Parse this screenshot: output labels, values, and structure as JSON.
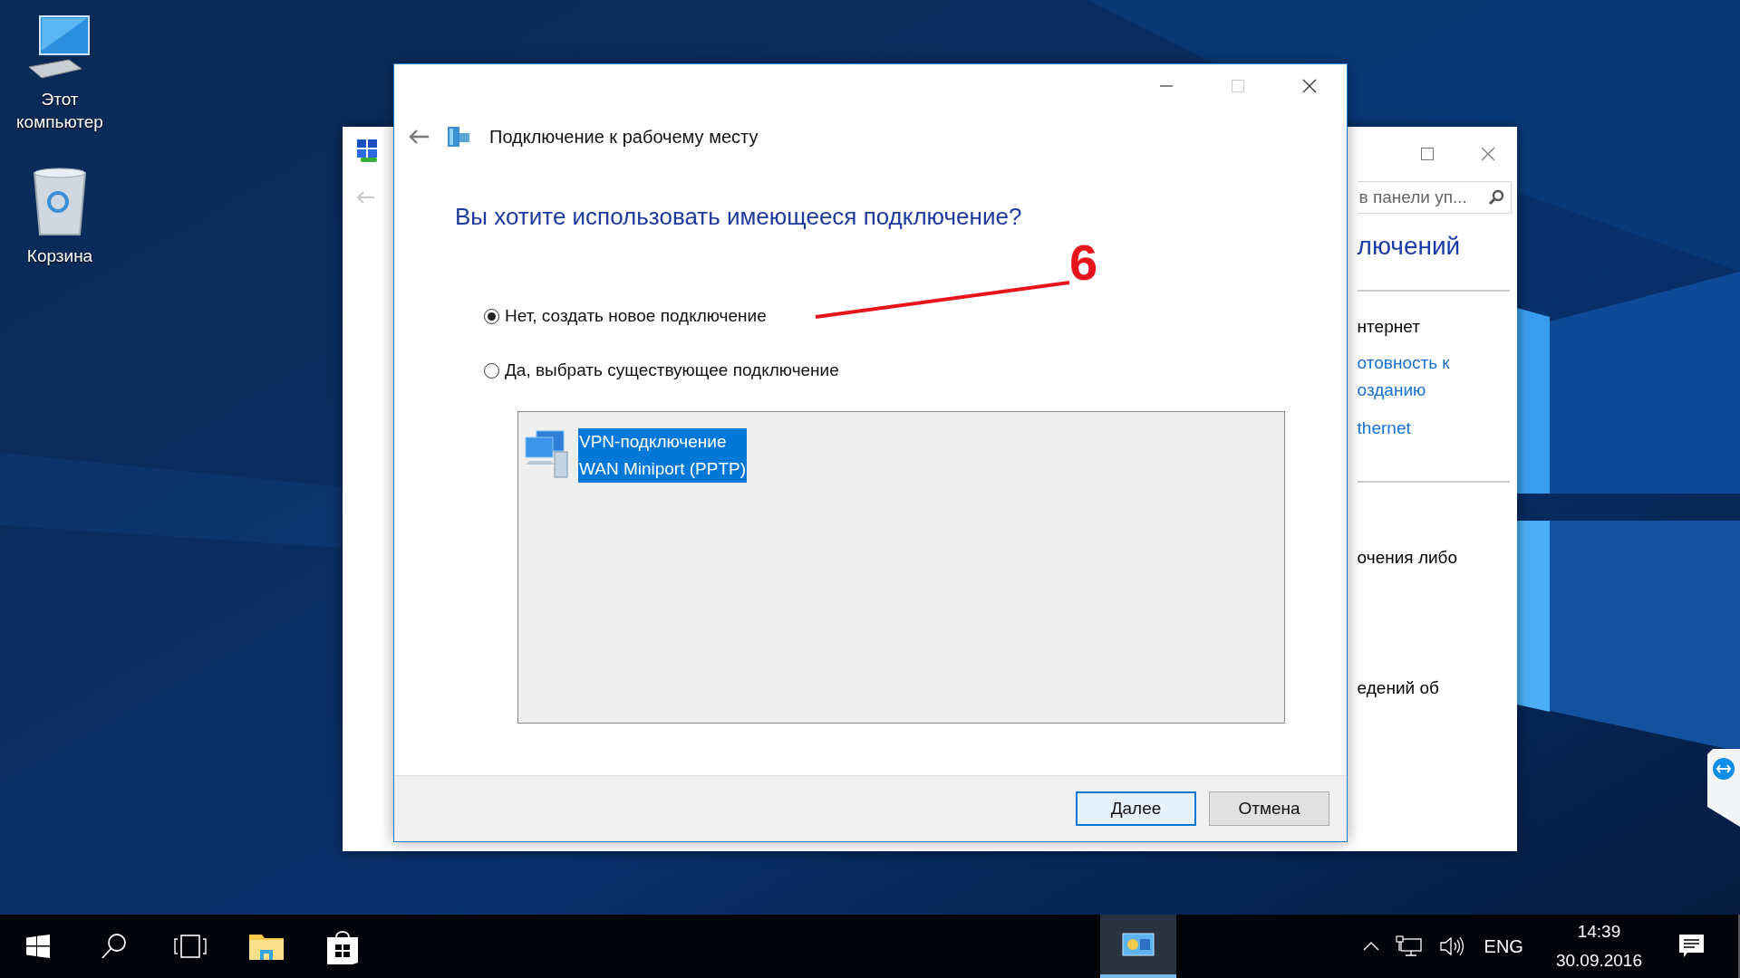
{
  "desktop_icons": [
    {
      "kind": "computer",
      "label": "Этот компьютер"
    },
    {
      "kind": "recycle-bin",
      "label": "Корзина"
    }
  ],
  "background_window": {
    "search": {
      "placeholder": "в панели уп..."
    },
    "heading": "лючений",
    "groups": [
      {
        "lines": [
          {
            "kind": "text",
            "text": "нтернет"
          },
          {
            "kind": "link",
            "text": "отовность к"
          },
          {
            "kind": "link",
            "text": "озданию"
          },
          {
            "kind": "link",
            "text": "thernet"
          }
        ]
      },
      {
        "lines": [
          {
            "kind": "text",
            "text": "очения либо"
          },
          {
            "kind": "text",
            "text": "едений об"
          }
        ]
      }
    ]
  },
  "dialog": {
    "title": "Подключение к рабочему месту",
    "question": "Вы хотите использовать имеющееся подключение?",
    "options": [
      {
        "label": "Нет, создать новое подключение",
        "selected": true
      },
      {
        "label": "Да, выбрать существующее подключение",
        "selected": false
      }
    ],
    "connections": [
      {
        "lines": [
          "VPN-подключение",
          "WAN Miniport (PPTP)"
        ],
        "selected": true
      }
    ],
    "buttons": [
      {
        "label": "Далее",
        "default": true
      },
      {
        "label": "Отмена",
        "default": false
      }
    ]
  },
  "annotation": {
    "label": "6"
  },
  "taskbar": {
    "items": [
      {
        "kind": "start",
        "active": false
      },
      {
        "kind": "search",
        "active": false
      },
      {
        "kind": "task-view",
        "active": false
      },
      {
        "kind": "explorer",
        "active": false
      },
      {
        "kind": "store",
        "active": false
      },
      {
        "kind": "network-app",
        "active": true
      }
    ],
    "language": "ENG",
    "time": "14:39",
    "date": "30.09.2016"
  }
}
